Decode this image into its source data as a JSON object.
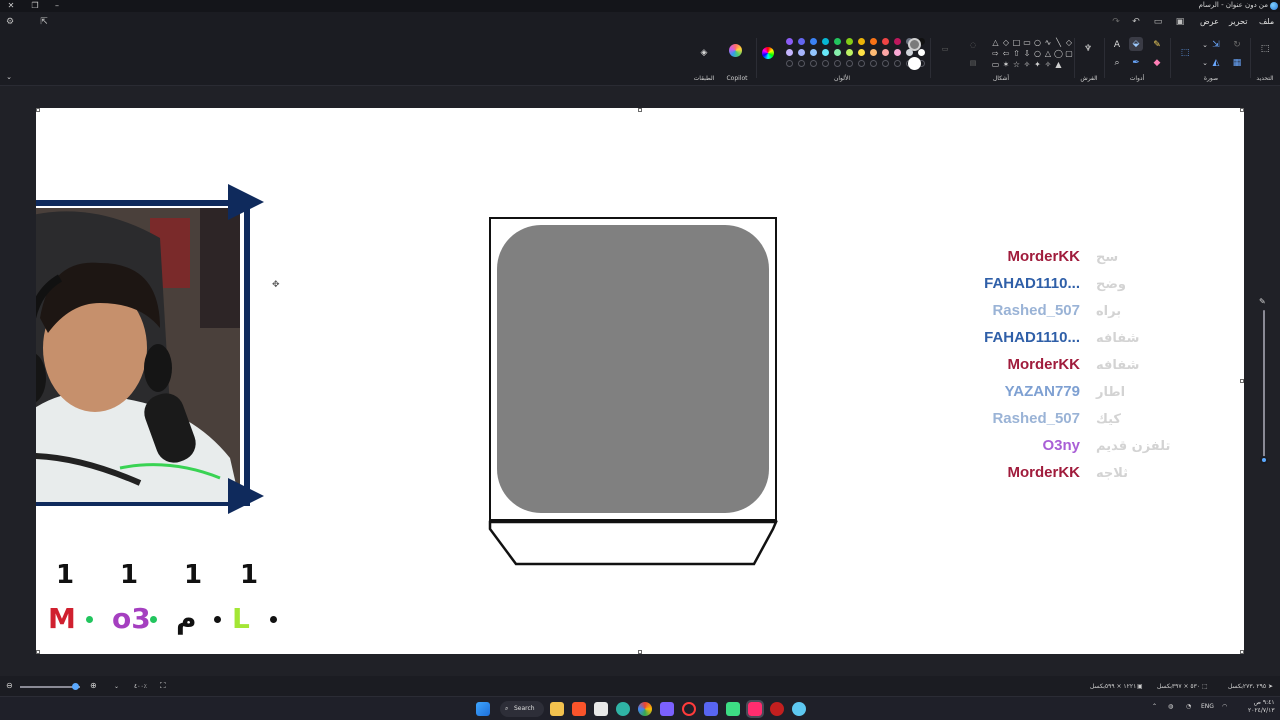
{
  "window": {
    "title": "من دون عنوان - الرسام"
  },
  "menu": {
    "file": "ملف",
    "edit": "تحرير",
    "view": "عرض"
  },
  "ribbon": {
    "groups": {
      "selection": "التحديد",
      "image": "صورة",
      "tools": "أدوات",
      "brushes": "الفرش",
      "shapes": "أشكال",
      "colors": "الألوان",
      "copilot": "Copilot",
      "layers": "الطبقات"
    },
    "palette_row1": [
      "#8b5cf6",
      "#6366f1",
      "#3b82f6",
      "#06b6d4",
      "#22c55e",
      "#84cc16",
      "#eab308",
      "#f97316",
      "#ef4444",
      "#be185d",
      "#6b7280",
      "#111111"
    ],
    "palette_row2": [
      "#c4b5fd",
      "#a5b4fc",
      "#93c5fd",
      "#67e8f9",
      "#86efac",
      "#bef264",
      "#fde047",
      "#fdba74",
      "#fca5a5",
      "#f9a8d4",
      "#d1d5db",
      "#ffffff"
    ],
    "primary_color": "#7a7a7a",
    "secondary_color": "#ffffff"
  },
  "canvas": {
    "chat": [
      {
        "name": "MorderKK",
        "color": "#a01c3c",
        "message": "سح"
      },
      {
        "name": "FAHAD1110...",
        "color": "#2f5fa8",
        "message": "وضح"
      },
      {
        "name": "Rashed_507",
        "color": "#9ab3d6",
        "message": "براه"
      },
      {
        "name": "FAHAD1110...",
        "color": "#2f5fa8",
        "message": "شفافه"
      },
      {
        "name": "MorderKK",
        "color": "#a01c3c",
        "message": "شفافه"
      },
      {
        "name": "YAZAN779",
        "color": "#7ea0d2",
        "message": "اطار"
      },
      {
        "name": "Rashed_507",
        "color": "#9ab3d6",
        "message": "كيك"
      },
      {
        "name": "O3ny",
        "color": "#a95fd6",
        "message": "تلفزن قديم"
      },
      {
        "name": "MorderKK",
        "color": "#a01c3c",
        "message": "ثلاجه"
      }
    ],
    "scores": [
      {
        "count": "1",
        "letter": "M",
        "color": "#d0202f",
        "dot": "#22c55e"
      },
      {
        "count": "1",
        "letter": "o3",
        "color": "#a53fc0",
        "dot": "#22c55e"
      },
      {
        "count": "1",
        "letter": "م",
        "color": "#111111",
        "dot": "#111111"
      },
      {
        "count": "1",
        "letter": "L",
        "color": "#a3e635",
        "dot": "#111111"
      }
    ]
  },
  "statusbar": {
    "zoom": "٤٠٠٪",
    "canvas_size": "١٢٢١ × ٥٩٩بكسل",
    "selection_size": "٥٣٠ × ٣٩٧بكسل",
    "cursor": "٢٩٥ ،٢٧٣بكسل"
  },
  "taskbar": {
    "search": "Search",
    "lang": "ENG",
    "time": "٩:٤١ ص",
    "date": "٢٠٢٤/٧/١٣"
  }
}
